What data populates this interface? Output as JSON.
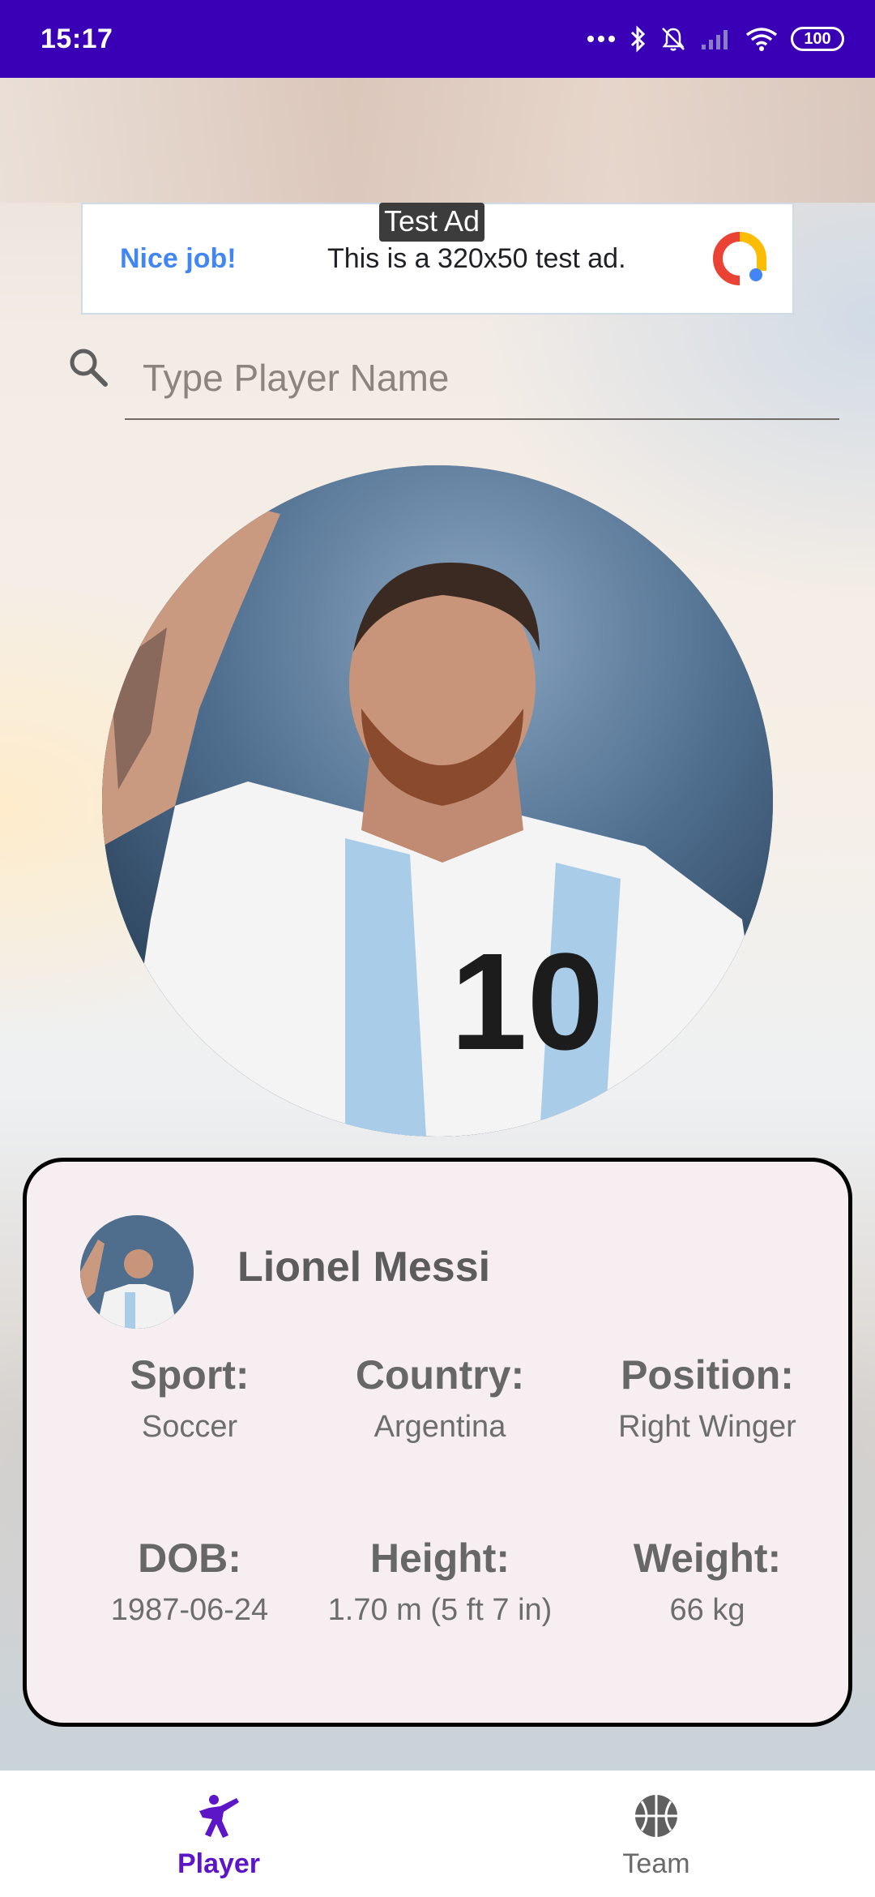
{
  "status_bar": {
    "time": "15:17",
    "battery": "100",
    "icons": [
      "more-dots-icon",
      "bluetooth-icon",
      "bell-muted-icon",
      "signal-icon",
      "wifi-icon",
      "battery-icon"
    ]
  },
  "ad": {
    "tag": "Test Ad",
    "headline": "Nice job!",
    "body": "This is a 320x50 test ad.",
    "logo_icon": "ad-logo-icon"
  },
  "search": {
    "placeholder": "Type Player Name",
    "value": ""
  },
  "player": {
    "name": "Lionel Messi",
    "stats": [
      {
        "label": "Sport:",
        "value": "Soccer"
      },
      {
        "label": "Country:",
        "value": "Argentina"
      },
      {
        "label": "Position:",
        "value": "Right Winger"
      },
      {
        "label": "DOB:",
        "value": "1987-06-24"
      },
      {
        "label": "Height:",
        "value": "1.70 m (5 ft 7 in)"
      },
      {
        "label": "Weight:",
        "value": "66 kg"
      }
    ]
  },
  "nav": {
    "items": [
      {
        "label": "Player",
        "icon": "player-icon",
        "active": true
      },
      {
        "label": "Team",
        "icon": "basketball-icon",
        "active": false
      }
    ]
  },
  "colors": {
    "status_bar": "#3a00b6",
    "accent": "#5c16c8",
    "ad_blue": "#4285f4",
    "card_bg": "#f6eef1"
  }
}
